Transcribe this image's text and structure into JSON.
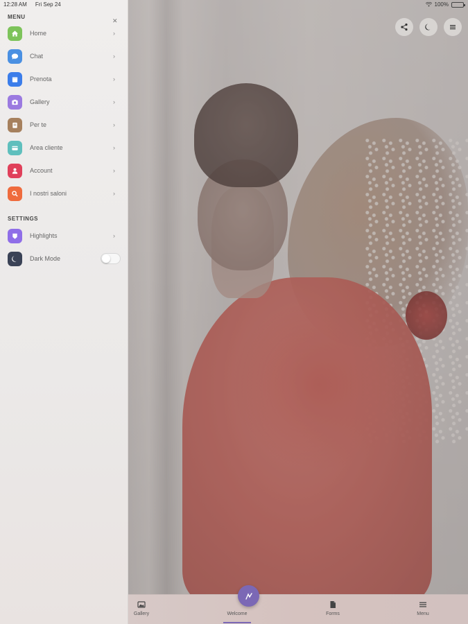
{
  "status_bar": {
    "time": "12:28 AM",
    "date": "Fri Sep 24",
    "battery": "100%"
  },
  "menu": {
    "section_title": "MENU",
    "items": [
      {
        "label": "Home",
        "icon": "home-icon",
        "color": "#7dc35a"
      },
      {
        "label": "Chat",
        "icon": "chat-icon",
        "color": "#4a90e2"
      },
      {
        "label": "Prenota",
        "icon": "calendar-icon",
        "color": "#3b7dea"
      },
      {
        "label": "Gallery",
        "icon": "gallery-icon",
        "color": "#9b7ae0"
      },
      {
        "label": "Per te",
        "icon": "gift-icon",
        "color": "#a6805d"
      },
      {
        "label": "Area cliente",
        "icon": "card-icon",
        "color": "#5fbfbd"
      },
      {
        "label": "Account",
        "icon": "user-icon",
        "color": "#e0405a"
      },
      {
        "label": "I nostri saloni",
        "icon": "search-icon",
        "color": "#ef6b3d"
      }
    ]
  },
  "settings": {
    "section_title": "SETTINGS",
    "highlights": {
      "label": "Highlights",
      "icon": "highlights-icon",
      "color": "#8f6ee8"
    },
    "dark_mode": {
      "label": "Dark Mode",
      "icon": "moon-icon",
      "color": "#3a4256"
    }
  },
  "tabs": [
    {
      "label": "Gallery",
      "icon": "gallery-icon"
    },
    {
      "label": "Welcome",
      "icon": "welcome-icon"
    },
    {
      "label": "Forms",
      "icon": "document-icon"
    },
    {
      "label": "Menu",
      "icon": "menu-icon"
    }
  ],
  "accent_color": "#7b68b5"
}
